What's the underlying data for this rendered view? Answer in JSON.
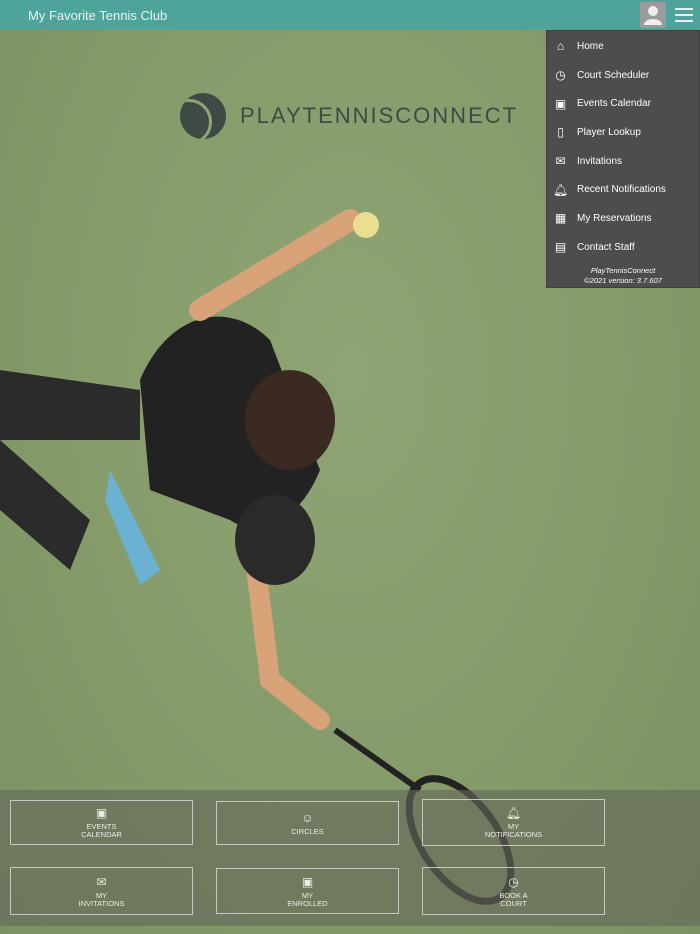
{
  "header": {
    "title": "My Favorite Tennis Club"
  },
  "logo": {
    "text": "PLAYTENNISCONNECT"
  },
  "menu": {
    "items": [
      {
        "label": "Home",
        "icon": "home-icon"
      },
      {
        "label": "Court Scheduler",
        "icon": "clock-icon"
      },
      {
        "label": "Events Calendar",
        "icon": "calendar-star-icon"
      },
      {
        "label": "Player Lookup",
        "icon": "book-icon"
      },
      {
        "label": "Invitations",
        "icon": "envelope-open-icon"
      },
      {
        "label": "Recent Notifications",
        "icon": "bell-icon"
      },
      {
        "label": "My Reservations",
        "icon": "calendar-icon"
      },
      {
        "label": "Contact Staff",
        "icon": "contact-icon"
      }
    ],
    "footer_name": "PlayTennisConnect",
    "footer_version": "©2021 version: 3.7.607"
  },
  "tiles": [
    {
      "line1": "EVENTS",
      "line2": "CALENDAR",
      "icon": "calendar-star-icon"
    },
    {
      "line1": "",
      "line2": "CIRCLES",
      "icon": "circles-icon"
    },
    {
      "line1": "MY",
      "line2": "NOTIFICATIONS",
      "icon": "bell-icon"
    },
    {
      "line1": "MY",
      "line2": "INVITATIONS",
      "icon": "envelope-open-icon"
    },
    {
      "line1": "MY",
      "line2": "ENROLLED",
      "icon": "calendar-star-icon"
    },
    {
      "line1": "BOOK A",
      "line2": "COURT",
      "icon": "clock-icon"
    }
  ]
}
